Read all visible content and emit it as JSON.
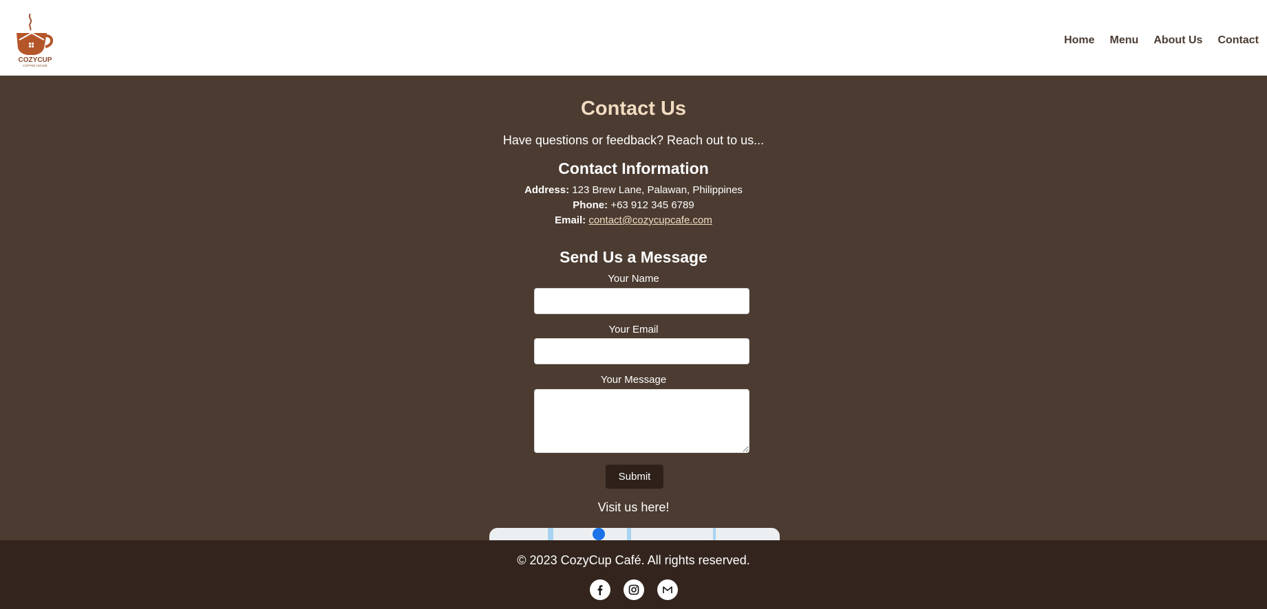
{
  "brand": {
    "logo_text": "COZYCUP",
    "logo_subtext": "COFFEE HOUSE"
  },
  "nav": {
    "items": [
      {
        "label": "Home"
      },
      {
        "label": "Menu"
      },
      {
        "label": "About Us"
      },
      {
        "label": "Contact"
      }
    ]
  },
  "contact": {
    "title": "Contact Us",
    "intro": "Have questions or feedback? Reach out to us...",
    "info_title": "Contact Information",
    "address_label": "Address:",
    "address_value": "123 Brew Lane, Palawan, Philippines",
    "phone_label": "Phone:",
    "phone_value": "+63 912 345 6789",
    "email_label": "Email:",
    "email_value": "contact@cozycupcafe.com"
  },
  "form": {
    "title": "Send Us a Message",
    "name_label": "Your Name",
    "name_value": "",
    "email_label": "Your Email",
    "email_value": "",
    "message_label": "Your Message",
    "message_value": "",
    "submit_label": "Submit"
  },
  "visit": {
    "label": "Visit us here!"
  },
  "footer": {
    "copyright": "© 2023 CozyCup Café. All rights reserved.",
    "socials": [
      {
        "icon": "facebook-icon"
      },
      {
        "icon": "instagram-icon"
      },
      {
        "icon": "gmail-icon"
      }
    ]
  },
  "colors": {
    "background": "#4b3b31",
    "navbar": "#ffffff",
    "footer": "#33251d",
    "accent": "#f2dcc1",
    "button": "#2d211a",
    "nav_text": "#4b3b31"
  }
}
